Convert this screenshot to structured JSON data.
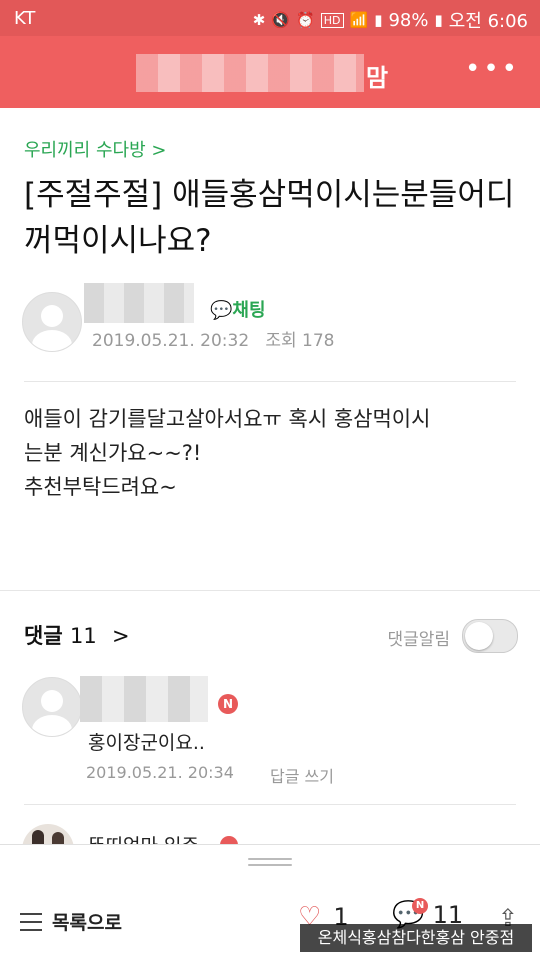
{
  "status_bar": {
    "carrier": "KT",
    "battery": "98%",
    "time": "오전 6:06",
    "icons": [
      "bluetooth-icon",
      "mute-icon",
      "alarm-icon",
      "hd-icon",
      "wifi-icon",
      "signal-icon",
      "battery-icon"
    ]
  },
  "header": {
    "title_tail": "맘",
    "more_icon": "more-icon"
  },
  "post": {
    "category": "우리끼리 수다방 >",
    "title": "[주절주절] 애들홍삼먹이시는분들어디꺼먹이시나요?",
    "chat_label": "채팅",
    "date": "2019.05.21. 20:32",
    "views": "조회 178",
    "body_line1": "애들이 감기를달고살아서요ㅠ 혹시 홍삼먹이시",
    "body_line2": "는분 계신가요~~?!",
    "body_line3": "추천부탁드려요~"
  },
  "comments": {
    "label": "댓글",
    "count": "11",
    "chevron": ">",
    "alarm_label": "댓글알림",
    "alarm_on": false,
    "items": [
      {
        "badge": "N",
        "text": "홍이장군이요..",
        "date": "2019.05.21. 20:34",
        "reply_label": "답글 쓰기"
      },
      {
        "name_partial": "뚜띠엄마 입주"
      }
    ]
  },
  "bottom_bar": {
    "list_label": "목록으로",
    "likes": "1",
    "comment_count": "11",
    "new_badge": "N"
  },
  "watermark": "온체식홍삼참다한홍삼 안중점",
  "colors": {
    "header_red": "#ef5f5f",
    "status_red": "#e25858",
    "green": "#2aa653",
    "badge_red": "#e85a5a"
  }
}
